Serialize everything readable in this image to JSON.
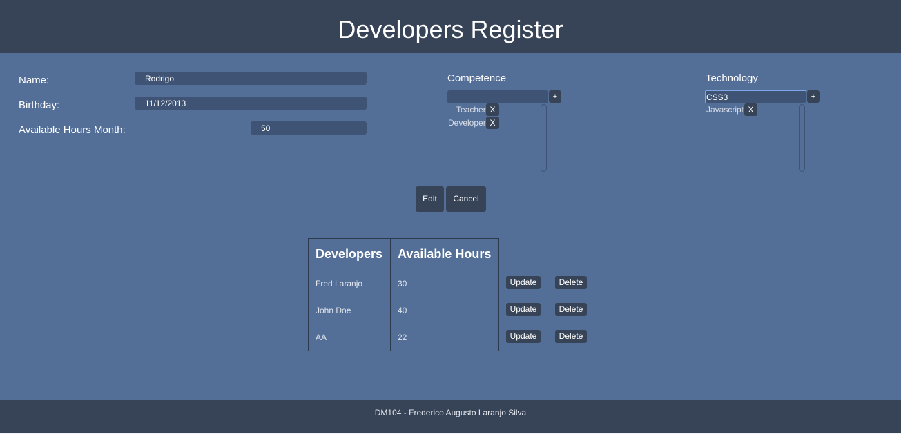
{
  "header": {
    "title": "Developers Register"
  },
  "form": {
    "name_label": "Name:",
    "name_value": "Rodrigo",
    "birthday_label": "Birthday:",
    "birthday_value": "11/12/2013",
    "hours_label": "Available Hours Month:",
    "hours_value": "50"
  },
  "competence": {
    "title": "Competence",
    "input_value": "",
    "add_label": "+",
    "items": [
      {
        "label": "Teacher",
        "remove_label": "X"
      },
      {
        "label": "Developer",
        "remove_label": "X"
      }
    ]
  },
  "technology": {
    "title": "Technology",
    "input_value": "CSS3",
    "add_label": "+",
    "items": [
      {
        "label": "Javascript",
        "remove_label": "X"
      }
    ]
  },
  "actions": {
    "edit_label": "Edit",
    "cancel_label": "Cancel"
  },
  "table": {
    "headers": [
      "Developers",
      "Available Hours"
    ],
    "rows": [
      {
        "name": "Fred Laranjo",
        "hours": "30",
        "update_label": "Update",
        "delete_label": "Delete"
      },
      {
        "name": "John Doe",
        "hours": "40",
        "update_label": "Update",
        "delete_label": "Delete"
      },
      {
        "name": "AA",
        "hours": "22",
        "update_label": "Update",
        "delete_label": "Delete"
      }
    ]
  },
  "footer": {
    "text": "DM104 - Frederico Augusto Laranjo Silva"
  },
  "colors": {
    "background": "#546f97",
    "header_bg": "#374356",
    "input_bg": "#3f5474",
    "focus_border": "#7fa6e8"
  }
}
